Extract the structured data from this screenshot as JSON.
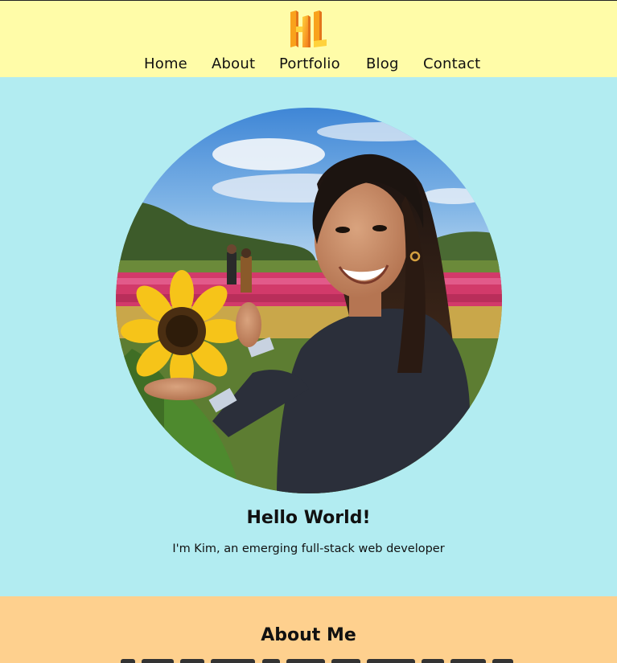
{
  "logo": {
    "icon": "hl-monogram-logo-icon"
  },
  "nav": {
    "items": [
      {
        "label": "Home"
      },
      {
        "label": "About"
      },
      {
        "label": "Portfolio"
      },
      {
        "label": "Blog"
      },
      {
        "label": "Contact"
      }
    ]
  },
  "hero": {
    "photo": "profile-photo-sunflower-field",
    "title": "Hello World!",
    "subtitle": "I'm Kim, an emerging full-stack web developer"
  },
  "about": {
    "title": "About Me"
  },
  "colors": {
    "header_bg": "#fffca8",
    "hero_bg": "#b2ecf1",
    "about_bg": "#fed08e",
    "logo_orange": "#f9a21c",
    "logo_yellow": "#ffd23c"
  }
}
